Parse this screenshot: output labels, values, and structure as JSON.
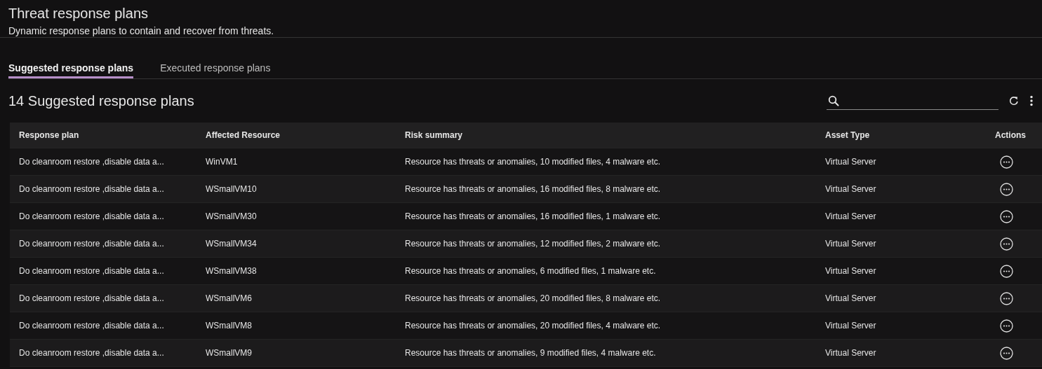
{
  "page": {
    "title": "Threat response plans",
    "subtitle": "Dynamic response plans to contain and recover from threats."
  },
  "tabs": [
    {
      "label": "Suggested response plans",
      "selected": true
    },
    {
      "label": "Executed response plans",
      "selected": false
    }
  ],
  "list": {
    "heading": "14 Suggested response plans"
  },
  "table": {
    "columns": [
      "Response plan",
      "Affected Resource",
      "Risk summary",
      "Asset Type",
      "Actions"
    ],
    "rows": [
      {
        "plan": "Do cleanroom restore ,disable data a...",
        "resource": "WinVM1",
        "risk": "Resource has threats or anomalies, 10 modified files, 4 malware etc.",
        "asset_type": "Virtual Server"
      },
      {
        "plan": "Do cleanroom restore ,disable data a...",
        "resource": "WSmallVM10",
        "risk": "Resource has threats or anomalies, 16 modified files, 8 malware etc.",
        "asset_type": "Virtual Server"
      },
      {
        "plan": "Do cleanroom restore ,disable data a...",
        "resource": "WSmallVM30",
        "risk": "Resource has threats or anomalies, 16 modified files, 1 malware etc.",
        "asset_type": "Virtual Server"
      },
      {
        "plan": "Do cleanroom restore ,disable data a...",
        "resource": "WSmallVM34",
        "risk": "Resource has threats or anomalies, 12 modified files, 2 malware etc.",
        "asset_type": "Virtual Server"
      },
      {
        "plan": "Do cleanroom restore ,disable data a...",
        "resource": "WSmallVM38",
        "risk": "Resource has threats or anomalies, 6 modified files, 1 malware etc.",
        "asset_type": "Virtual Server"
      },
      {
        "plan": "Do cleanroom restore ,disable data a...",
        "resource": "WSmallVM6",
        "risk": "Resource has threats or anomalies, 20 modified files, 8 malware etc.",
        "asset_type": "Virtual Server"
      },
      {
        "plan": "Do cleanroom restore ,disable data a...",
        "resource": "WSmallVM8",
        "risk": "Resource has threats or anomalies, 20 modified files, 4 malware etc.",
        "asset_type": "Virtual Server"
      },
      {
        "plan": "Do cleanroom restore ,disable data a...",
        "resource": "WSmallVM9",
        "risk": "Resource has threats or anomalies, 9 modified files, 4 malware etc.",
        "asset_type": "Virtual Server"
      }
    ]
  }
}
